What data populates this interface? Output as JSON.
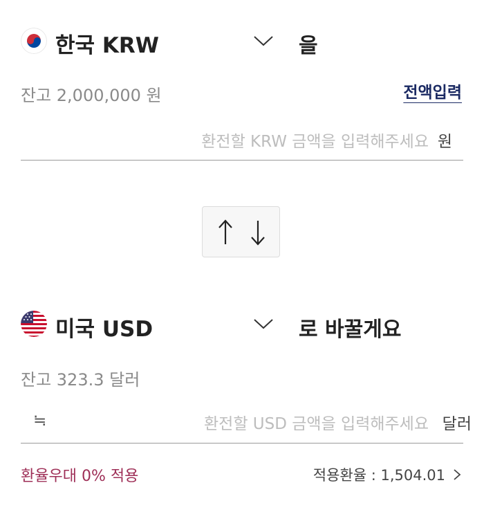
{
  "from": {
    "currency_label": "한국 KRW",
    "suffix": "을",
    "balance_text": "잔고 2,000,000 원",
    "full_amount_label": "전액입력",
    "amount_placeholder": "환전할 KRW 금액을 입력해주세요",
    "unit": "원",
    "flag_icon": "korea-flag-icon"
  },
  "to": {
    "currency_label": "미국 USD",
    "suffix": "로 바꿀게요",
    "balance_text": "잔고 323.3 달러",
    "approx_symbol": "≒",
    "amount_placeholder": "환전할 USD 금액을 입력해주세요",
    "unit": "달러",
    "flag_icon": "usa-flag-icon"
  },
  "swap": {
    "icon": "swap-arrows-icon"
  },
  "footer": {
    "preferential_text": "환율우대 0% 적용",
    "applied_rate_text": "적용환율 : 1,504.01"
  },
  "colors": {
    "accent_navy": "#1b2a63",
    "preferential": "#9e2f57",
    "placeholder": "#bdbdbd",
    "divider": "#9a9a9a"
  }
}
